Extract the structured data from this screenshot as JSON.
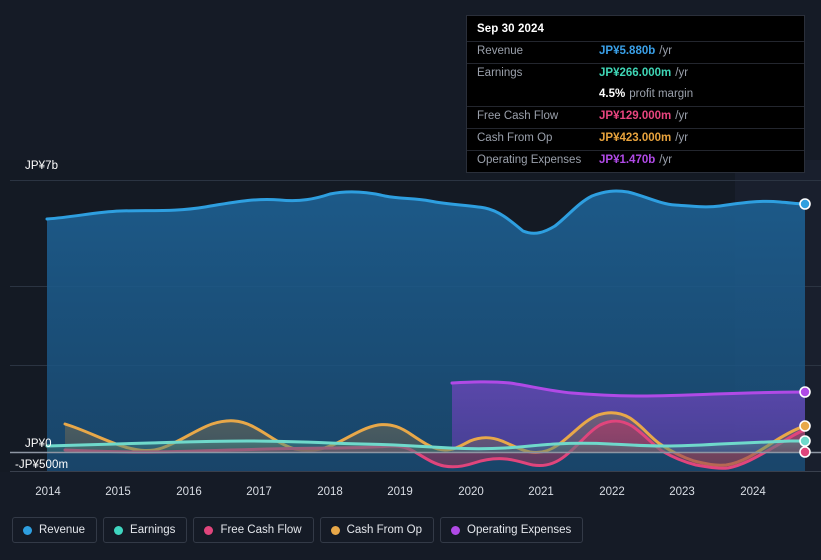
{
  "tooltip": {
    "date": "Sep 30 2024",
    "rows": [
      {
        "label": "Revenue",
        "value": "JP¥5.880b",
        "suffix": "/yr",
        "color": "#3aa0e8"
      },
      {
        "label": "Earnings",
        "value": "JP¥266.000m",
        "suffix": "/yr",
        "color": "#3fd6b6"
      },
      {
        "label": "",
        "value": "4.5%",
        "suffix": "profit margin",
        "color": "#ffffff"
      },
      {
        "label": "Free Cash Flow",
        "value": "JP¥129.000m",
        "suffix": "/yr",
        "color": "#e8457f"
      },
      {
        "label": "Cash From Op",
        "value": "JP¥423.000m",
        "suffix": "/yr",
        "color": "#e8a33d"
      },
      {
        "label": "Operating Expenses",
        "value": "JP¥1.470b",
        "suffix": "/yr",
        "color": "#b14ae8"
      }
    ]
  },
  "legend": {
    "items": [
      {
        "label": "Revenue",
        "color": "#2e9fe0"
      },
      {
        "label": "Earnings",
        "color": "#3fd6c0"
      },
      {
        "label": "Free Cash Flow",
        "color": "#e0457c"
      },
      {
        "label": "Cash From Op",
        "color": "#e8a849"
      },
      {
        "label": "Operating Expenses",
        "color": "#b04ae6"
      }
    ]
  },
  "axes": {
    "y_top_label": "JP¥7b",
    "y_zero_label": "JP¥0",
    "y_bottom_label": "-JP¥500m",
    "x_ticks": [
      "2014",
      "2015",
      "2016",
      "2017",
      "2018",
      "2019",
      "2020",
      "2021",
      "2022",
      "2023",
      "2024"
    ]
  },
  "chart_data": {
    "type": "area",
    "title": "",
    "xlabel": "",
    "ylabel": "",
    "ylim": [
      -500000000,
      7000000000
    ],
    "y_tick_labels": [
      "JP¥7b",
      "JP¥0",
      "-JP¥500m"
    ],
    "grid": true,
    "legend_position": "bottom",
    "currency": "JPY",
    "units": "per year",
    "x": [
      "2014",
      "2015",
      "2016",
      "2017",
      "2018",
      "2019",
      "2020",
      "2021",
      "2022",
      "2023",
      "2024",
      "2024-09-30"
    ],
    "series": [
      {
        "name": "Revenue",
        "color": "#2e9fe0",
        "filled": true,
        "values": [
          5.35,
          5.3,
          5.55,
          5.45,
          5.9,
          5.7,
          5.55,
          4.95,
          5.9,
          5.7,
          5.75,
          5.88
        ],
        "unit": "JP¥b"
      },
      {
        "name": "Earnings",
        "color": "#3fd6c0",
        "filled": true,
        "values": [
          0.03,
          0.045,
          0.06,
          0.04,
          0.085,
          0.06,
          0.045,
          0.12,
          0.14,
          0.11,
          0.18,
          0.266
        ],
        "unit": "JP¥b"
      },
      {
        "name": "Free Cash Flow",
        "color": "#e0457c",
        "filled": true,
        "values": [
          0.01,
          0.02,
          0.03,
          0.02,
          0.09,
          -0.2,
          -0.24,
          -0.08,
          0.7,
          0.18,
          -0.38,
          0.129
        ],
        "unit": "JP¥b"
      },
      {
        "name": "Cash From Op",
        "color": "#e8a849",
        "filled": true,
        "values": [
          0.31,
          0.03,
          0.33,
          0.08,
          0.35,
          0.13,
          0.27,
          0.21,
          0.76,
          0.33,
          -0.26,
          0.423
        ],
        "unit": "JP¥b"
      },
      {
        "name": "Operating Expenses",
        "color": "#b04ae6",
        "filled": true,
        "starts_at": "2019-09",
        "values": [
          null,
          null,
          null,
          null,
          null,
          null,
          1.64,
          1.52,
          1.48,
          1.44,
          1.45,
          1.47
        ],
        "unit": "JP¥b"
      }
    ]
  }
}
